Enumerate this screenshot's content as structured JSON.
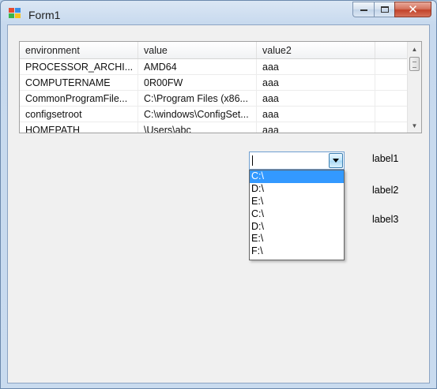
{
  "window": {
    "title": "Form1",
    "close_glyph": "✕"
  },
  "grid": {
    "columns": [
      "environment",
      "value",
      "value2",
      ""
    ],
    "rows": [
      [
        "PROCESSOR_ARCHI...",
        "AMD64",
        "aaa",
        ""
      ],
      [
        "COMPUTERNAME",
        "0R00FW",
        "aaa",
        ""
      ],
      [
        "CommonProgramFile...",
        "C:\\Program Files (x86...",
        "aaa",
        ""
      ],
      [
        "configsetroot",
        "C:\\windows\\ConfigSet...",
        "aaa",
        ""
      ],
      [
        "HOMEPATH",
        "\\Users\\abc",
        "aaa",
        ""
      ]
    ]
  },
  "combo": {
    "value": "",
    "options": [
      "C:\\",
      "D:\\",
      "E:\\",
      "C:\\",
      "D:\\",
      "E:\\",
      "F:\\"
    ],
    "selected_index": 0
  },
  "labels": [
    "label1",
    "label2",
    "label3"
  ],
  "colors": {
    "selection": "#3399ff",
    "close_button": "#c2432a"
  },
  "icons": [
    "app-icon",
    "minimize-icon",
    "maximize-icon",
    "close-icon",
    "scroll-up-icon",
    "scroll-down-icon",
    "dropdown-arrow-icon"
  ]
}
